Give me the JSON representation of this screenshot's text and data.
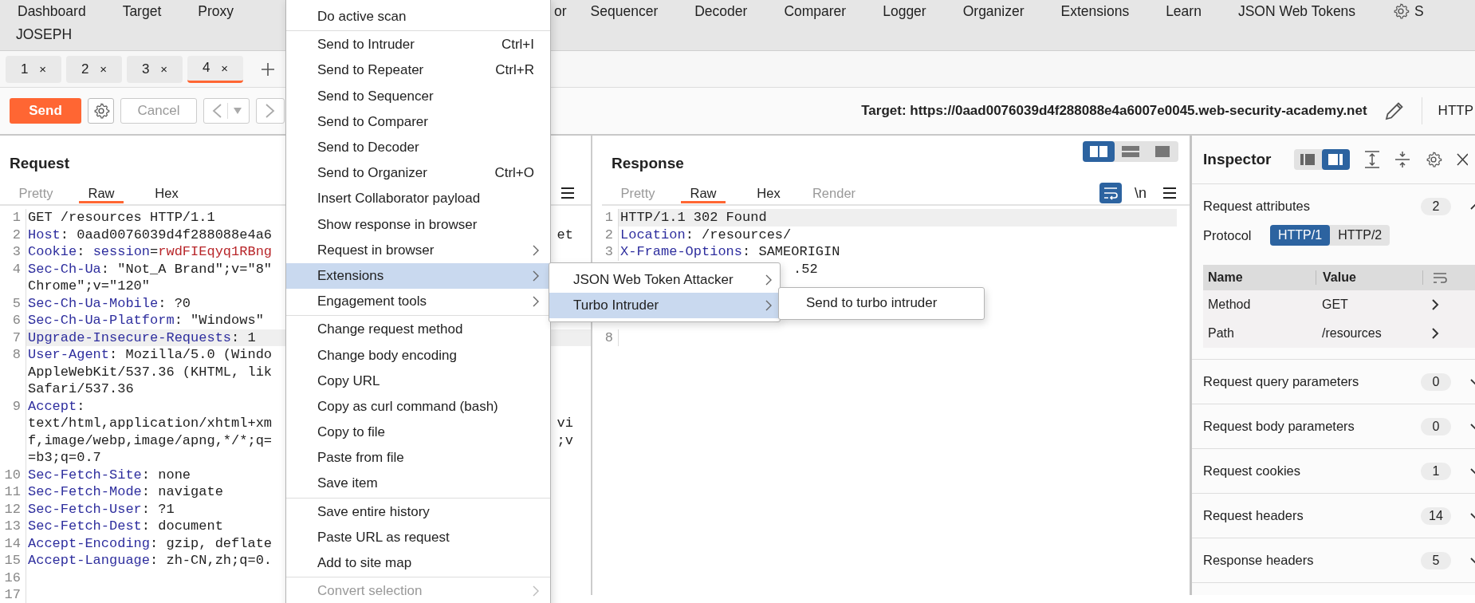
{
  "top_nav": {
    "row1": [
      {
        "label": "Dashboard",
        "kind": "item"
      },
      {
        "label": "Target",
        "kind": "item"
      },
      {
        "label": "Proxy",
        "kind": "item"
      },
      {
        "label": "or",
        "kind": "fragment"
      },
      {
        "label": "Sequencer",
        "kind": "item"
      },
      {
        "label": "Decoder",
        "kind": "item"
      },
      {
        "label": "Comparer",
        "kind": "item"
      },
      {
        "label": "Logger",
        "kind": "item"
      },
      {
        "label": "Organizer",
        "kind": "item"
      },
      {
        "label": "Extensions",
        "kind": "item"
      },
      {
        "label": "Learn",
        "kind": "item"
      },
      {
        "label": "JSON Web Tokens",
        "kind": "item"
      }
    ],
    "settings_label": "S",
    "row2": [
      {
        "label": "JOSEPH"
      }
    ]
  },
  "repeater_tabs": [
    {
      "label": "1",
      "close": "×",
      "selected": false
    },
    {
      "label": "2",
      "close": "×",
      "selected": false
    },
    {
      "label": "3",
      "close": "×",
      "selected": false
    },
    {
      "label": "4",
      "close": "×",
      "selected": true
    }
  ],
  "toolbar": {
    "send": "Send",
    "cancel": "Cancel",
    "target": "Target: https://0aad0076039d4f288088e4a6007e0045.web-security-academy.net",
    "http_version": "HTTP"
  },
  "request": {
    "title": "Request",
    "tabs": [
      {
        "label": "Pretty",
        "selected": false,
        "disabled": true
      },
      {
        "label": "Raw",
        "selected": true,
        "disabled": false
      },
      {
        "label": "Hex",
        "selected": false,
        "disabled": false
      }
    ],
    "lines": [
      {
        "num": "1",
        "current": false,
        "parts": [
          {
            "text": "GET /resources HTTP/1.1",
            "kind": "plain"
          }
        ]
      },
      {
        "num": "2",
        "current": false,
        "parts": [
          {
            "text": "Host",
            "kind": "name"
          },
          {
            "text": ": 0aad0076039d4f288088e4a6",
            "kind": "plain"
          }
        ],
        "tail": "et"
      },
      {
        "num": "3",
        "current": false,
        "parts": [
          {
            "text": "Cookie",
            "kind": "name"
          },
          {
            "text": ": ",
            "kind": "plain"
          },
          {
            "text": "session",
            "kind": "param"
          },
          {
            "text": "=",
            "kind": "plain"
          },
          {
            "text": "rwdFIEqyq1RBng",
            "kind": "value"
          }
        ]
      },
      {
        "num": "4",
        "current": false,
        "parts": [
          {
            "text": "Sec-Ch-Ua",
            "kind": "name"
          },
          {
            "text": ": \"Not_A Brand\";v=\"8\"",
            "kind": "plain"
          }
        ],
        "more": [
          {
            "text": "Chrome\";v=\"120\""
          }
        ]
      },
      {
        "num": "5",
        "current": false,
        "parts": [
          {
            "text": "Sec-Ch-Ua-Mobile",
            "kind": "name"
          },
          {
            "text": ": ?0",
            "kind": "plain"
          }
        ]
      },
      {
        "num": "6",
        "current": false,
        "parts": [
          {
            "text": "Sec-Ch-Ua-Platform",
            "kind": "name"
          },
          {
            "text": ": \"Windows\"",
            "kind": "plain"
          }
        ]
      },
      {
        "num": "7",
        "current": true,
        "parts": [
          {
            "text": "Upgrade-Insecure-Requests",
            "kind": "name"
          },
          {
            "text": ": 1",
            "kind": "plain"
          }
        ]
      },
      {
        "num": "8",
        "current": false,
        "parts": [
          {
            "text": "User-Agent",
            "kind": "name"
          },
          {
            "text": ": Mozilla/5.0 (Windo",
            "kind": "plain"
          }
        ],
        "more": [
          {
            "text": "AppleWebKit/537.36 (KHTML, lik"
          },
          {
            "text": "Safari/537.36"
          }
        ]
      },
      {
        "num": "9",
        "current": false,
        "parts": [
          {
            "text": "Accept",
            "kind": "name"
          },
          {
            "text": ":",
            "kind": "plain"
          }
        ],
        "more": [
          {
            "text": "text/html,application/xhtml+xm",
            "tail": "vi"
          },
          {
            "text": "f,image/webp,image/apng,*/*;q=",
            "tail": ";v"
          },
          {
            "text": "=b3;q=0.7"
          }
        ]
      },
      {
        "num": "10",
        "current": false,
        "parts": [
          {
            "text": "Sec-Fetch-Site",
            "kind": "name"
          },
          {
            "text": ": none",
            "kind": "plain"
          }
        ]
      },
      {
        "num": "11",
        "current": false,
        "parts": [
          {
            "text": "Sec-Fetch-Mode",
            "kind": "name"
          },
          {
            "text": ": navigate",
            "kind": "plain"
          }
        ]
      },
      {
        "num": "12",
        "current": false,
        "parts": [
          {
            "text": "Sec-Fetch-User",
            "kind": "name"
          },
          {
            "text": ": ?1",
            "kind": "plain"
          }
        ]
      },
      {
        "num": "13",
        "current": false,
        "parts": [
          {
            "text": "Sec-Fetch-Dest",
            "kind": "name"
          },
          {
            "text": ": document",
            "kind": "plain"
          }
        ]
      },
      {
        "num": "14",
        "current": false,
        "parts": [
          {
            "text": "Accept-Encoding",
            "kind": "name"
          },
          {
            "text": ": gzip, deflate",
            "kind": "plain"
          }
        ]
      },
      {
        "num": "15",
        "current": false,
        "parts": [
          {
            "text": "Accept-Language",
            "kind": "name"
          },
          {
            "text": ": zh-CN,zh;q=0.",
            "kind": "plain"
          }
        ]
      },
      {
        "num": "16",
        "current": false
      },
      {
        "num": "17",
        "current": false
      }
    ]
  },
  "response": {
    "title": "Response",
    "layouts": [
      {
        "kind": "columns",
        "selected": true
      },
      {
        "kind": "rows",
        "selected": false
      },
      {
        "kind": "single",
        "selected": false
      }
    ],
    "tabs": [
      {
        "label": "Pretty",
        "selected": false,
        "disabled": true
      },
      {
        "label": "Raw",
        "selected": true,
        "disabled": false
      },
      {
        "label": "Hex",
        "selected": false,
        "disabled": false
      },
      {
        "label": "Render",
        "selected": false,
        "disabled": true
      }
    ],
    "wrap_on": true,
    "newline_toggle": "\\n",
    "lines": [
      {
        "kind": "line",
        "num": "1",
        "current": true,
        "parts": [
          {
            "text": "HTTP/1.1 302 Found",
            "kind": "plain"
          }
        ]
      },
      {
        "kind": "line",
        "num": "2",
        "current": false,
        "parts": [
          {
            "text": "Location",
            "kind": "name"
          },
          {
            "text": ": /resources/",
            "kind": "plain"
          }
        ]
      },
      {
        "kind": "line",
        "num": "3",
        "current": false,
        "parts": [
          {
            "text": "X-Frame-Options",
            "kind": "name"
          },
          {
            "text": ": SAMEORIGIN",
            "kind": "plain"
          }
        ]
      },
      {
        "kind": "covered",
        "current": false,
        "parts": [
          {
            "text": ".52",
            "kind": "plain"
          }
        ]
      },
      {
        "kind": "covered",
        "current": false
      },
      {
        "kind": "covered",
        "current": false
      },
      {
        "kind": "covered",
        "current": false
      },
      {
        "kind": "line",
        "num": "8",
        "current": false
      }
    ]
  },
  "inspector": {
    "title": "Inspector",
    "docked_right": true,
    "attributes": {
      "title": "Request attributes",
      "count": "2",
      "expanded": true,
      "protocol_label": "Protocol",
      "protocols": [
        {
          "label": "HTTP/1",
          "selected": true
        },
        {
          "label": "HTTP/2",
          "selected": false
        }
      ],
      "columns": [
        "Name",
        "Value"
      ],
      "rows": [
        {
          "name": "Method",
          "value": "GET"
        },
        {
          "name": "Path",
          "value": "/resources"
        }
      ]
    },
    "sections": [
      {
        "title": "Request query parameters",
        "count": "0",
        "expanded": false
      },
      {
        "title": "Request body parameters",
        "count": "0",
        "expanded": false
      },
      {
        "title": "Request cookies",
        "count": "1",
        "expanded": false
      },
      {
        "title": "Request headers",
        "count": "14",
        "expanded": false
      },
      {
        "title": "Response headers",
        "count": "5",
        "expanded": false
      }
    ]
  },
  "context_menu": {
    "groups": [
      [
        {
          "label": "Do active scan",
          "submenu": false,
          "selected": false,
          "disabled": false
        }
      ],
      [
        {
          "label": "Send to Intruder",
          "shortcut": "Ctrl+I",
          "submenu": false,
          "selected": false,
          "disabled": false
        },
        {
          "label": "Send to Repeater",
          "shortcut": "Ctrl+R",
          "submenu": false,
          "selected": false,
          "disabled": false
        },
        {
          "label": "Send to Sequencer",
          "submenu": false,
          "selected": false,
          "disabled": false
        },
        {
          "label": "Send to Comparer",
          "submenu": false,
          "selected": false,
          "disabled": false
        },
        {
          "label": "Send to Decoder",
          "submenu": false,
          "selected": false,
          "disabled": false
        },
        {
          "label": "Send to Organizer",
          "shortcut": "Ctrl+O",
          "submenu": false,
          "selected": false,
          "disabled": false
        },
        {
          "label": "Insert Collaborator payload",
          "submenu": false,
          "selected": false,
          "disabled": false
        },
        {
          "label": "Show response in browser",
          "submenu": false,
          "selected": false,
          "disabled": false
        },
        {
          "label": "Request in browser",
          "submenu": true,
          "selected": false,
          "disabled": false
        },
        {
          "label": "Extensions",
          "submenu": true,
          "selected": true,
          "disabled": false
        },
        {
          "label": "Engagement tools",
          "submenu": true,
          "selected": false,
          "disabled": false
        }
      ],
      [
        {
          "label": "Change request method",
          "submenu": false,
          "selected": false,
          "disabled": false
        },
        {
          "label": "Change body encoding",
          "submenu": false,
          "selected": false,
          "disabled": false
        },
        {
          "label": "Copy URL",
          "submenu": false,
          "selected": false,
          "disabled": false
        },
        {
          "label": "Copy as curl command (bash)",
          "submenu": false,
          "selected": false,
          "disabled": false
        },
        {
          "label": "Copy to file",
          "submenu": false,
          "selected": false,
          "disabled": false
        },
        {
          "label": "Paste from file",
          "submenu": false,
          "selected": false,
          "disabled": false
        },
        {
          "label": "Save item",
          "submenu": false,
          "selected": false,
          "disabled": false
        }
      ],
      [
        {
          "label": "Save entire history",
          "submenu": false,
          "selected": false,
          "disabled": false
        },
        {
          "label": "Paste URL as request",
          "submenu": false,
          "selected": false,
          "disabled": false
        },
        {
          "label": "Add to site map",
          "submenu": false,
          "selected": false,
          "disabled": false
        }
      ],
      [
        {
          "label": "Convert selection",
          "submenu": true,
          "selected": false,
          "disabled": true
        }
      ]
    ]
  },
  "extensions_menu": [
    {
      "label": "JSON Web Token Attacker",
      "submenu": true,
      "selected": false
    },
    {
      "label": "Turbo Intruder",
      "submenu": true,
      "selected": true
    }
  ],
  "turbo_menu": [
    {
      "label": "Send to turbo intruder",
      "submenu": false,
      "selected": false
    }
  ]
}
